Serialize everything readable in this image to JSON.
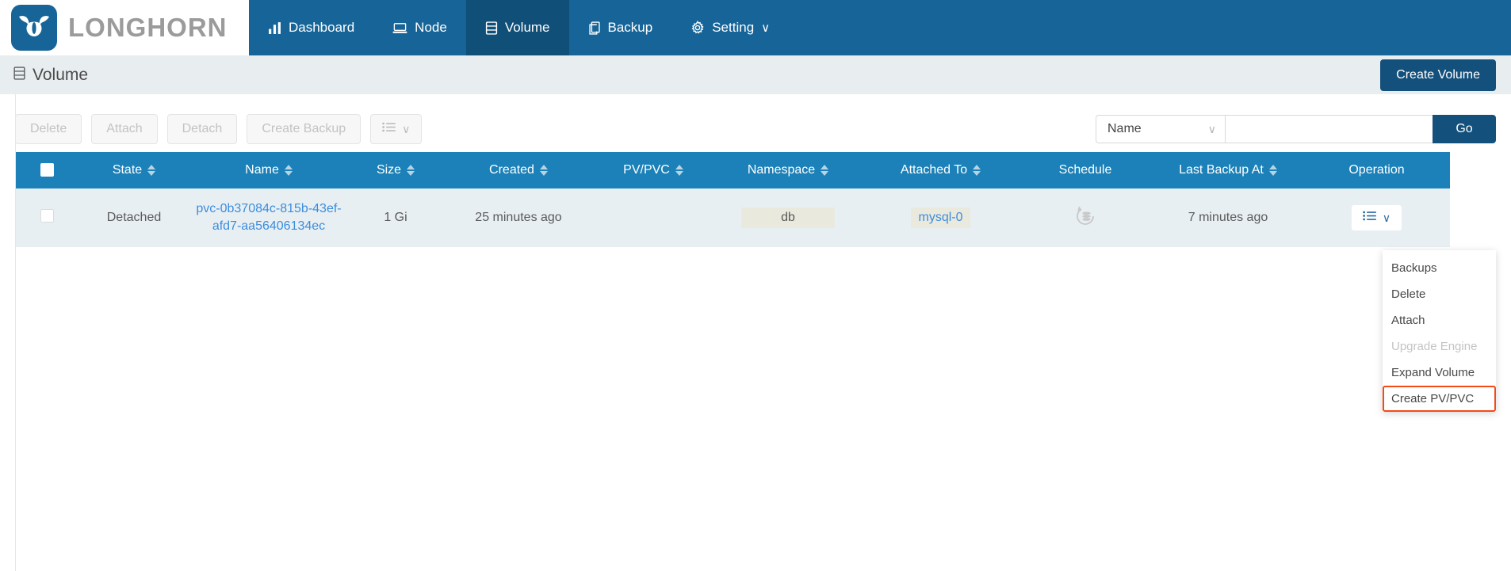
{
  "brand": {
    "name": "LONGHORN",
    "logo_icon": "longhorn-bull-icon"
  },
  "nav": {
    "items": [
      {
        "label": "Dashboard",
        "icon": "chart-bar-icon",
        "active": false
      },
      {
        "label": "Node",
        "icon": "server-icon",
        "active": false
      },
      {
        "label": "Volume",
        "icon": "database-stack-icon",
        "active": true
      },
      {
        "label": "Backup",
        "icon": "copy-icon",
        "active": false
      },
      {
        "label": "Setting",
        "icon": "gear-icon",
        "active": false,
        "caret": "∨"
      }
    ]
  },
  "page": {
    "title": "Volume",
    "title_icon": "volume-stack-icon",
    "create_button": "Create Volume"
  },
  "toolbar": {
    "buttons": [
      {
        "label": "Delete",
        "disabled": true
      },
      {
        "label": "Attach",
        "disabled": true
      },
      {
        "label": "Detach",
        "disabled": true
      },
      {
        "label": "Create Backup",
        "disabled": true
      }
    ],
    "columns_button_icon": "list-lines-icon",
    "columns_caret": "∨"
  },
  "search": {
    "filter_selected": "Name",
    "filter_caret": "∨",
    "input_value": "",
    "placeholder": "",
    "go_label": "Go"
  },
  "table": {
    "columns": [
      {
        "label": "",
        "sortable": false,
        "key": "check"
      },
      {
        "label": "State",
        "sortable": true
      },
      {
        "label": "Name",
        "sortable": true
      },
      {
        "label": "Size",
        "sortable": true
      },
      {
        "label": "Created",
        "sortable": true
      },
      {
        "label": "PV/PVC",
        "sortable": true
      },
      {
        "label": "Namespace",
        "sortable": true
      },
      {
        "label": "Attached To",
        "sortable": true
      },
      {
        "label": "Schedule",
        "sortable": false
      },
      {
        "label": "Last Backup At",
        "sortable": true
      },
      {
        "label": "Operation",
        "sortable": false
      }
    ],
    "rows": [
      {
        "state": "Detached",
        "name": "pvc-0b37084c-815b-43ef-afd7-aa56406134ec",
        "size": "1 Gi",
        "created": "25 minutes ago",
        "pvpvc": "",
        "namespace": "db",
        "attached_to": "mysql-0",
        "schedule_icon": "recurring-backup-icon",
        "last_backup_at": "7 minutes ago",
        "operation_icon": "list-lines-icon",
        "operation_caret": "∨"
      }
    ]
  },
  "dropdown": {
    "items": [
      {
        "label": "Backups",
        "disabled": false,
        "highlighted": false
      },
      {
        "label": "Delete",
        "disabled": false,
        "highlighted": false
      },
      {
        "label": "Attach",
        "disabled": false,
        "highlighted": false
      },
      {
        "label": "Upgrade Engine",
        "disabled": true,
        "highlighted": false
      },
      {
        "label": "Expand Volume",
        "disabled": false,
        "highlighted": false
      },
      {
        "label": "Create PV/PVC",
        "disabled": false,
        "highlighted": true
      }
    ]
  },
  "colors": {
    "nav_bg": "#176598",
    "nav_active_bg": "#0f4f78",
    "primary": "#14507c",
    "table_header": "#1b81b8",
    "row_bg": "#e8eff2",
    "link": "#3c8dde",
    "highlight_border": "#f44a17"
  }
}
